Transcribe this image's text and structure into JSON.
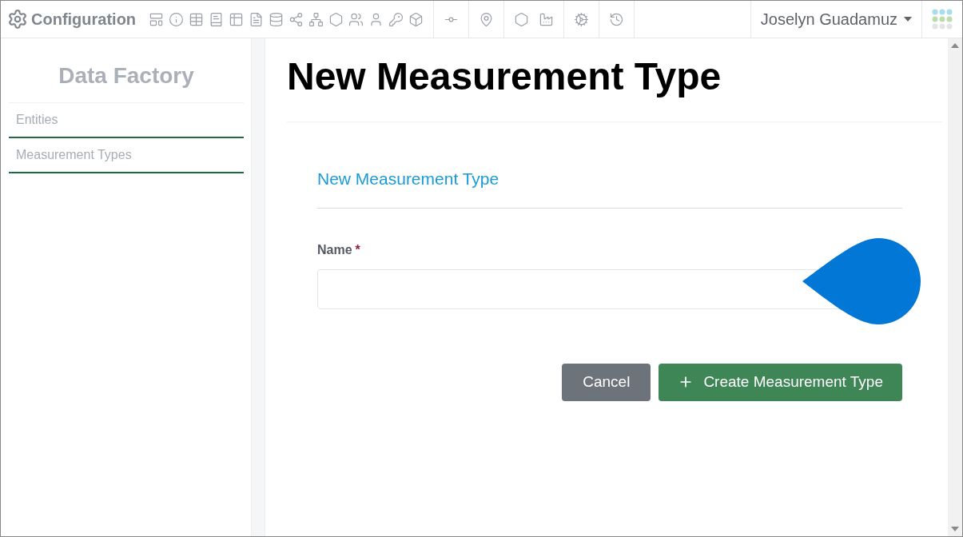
{
  "app": {
    "title": "Configuration"
  },
  "user": {
    "name": "Joselyn Guadamuz"
  },
  "sidebar": {
    "title": "Data Factory",
    "items": [
      {
        "label": "Entities"
      },
      {
        "label": "Measurement Types"
      }
    ]
  },
  "page": {
    "title": "New Measurement Type"
  },
  "form": {
    "title": "New Measurement Type",
    "fields": [
      {
        "label": "Name",
        "required_mark": "*"
      }
    ],
    "buttons": [
      {
        "kind": "cancel",
        "label": "Cancel"
      },
      {
        "kind": "submit",
        "label": "Create Measurement Type"
      }
    ]
  }
}
